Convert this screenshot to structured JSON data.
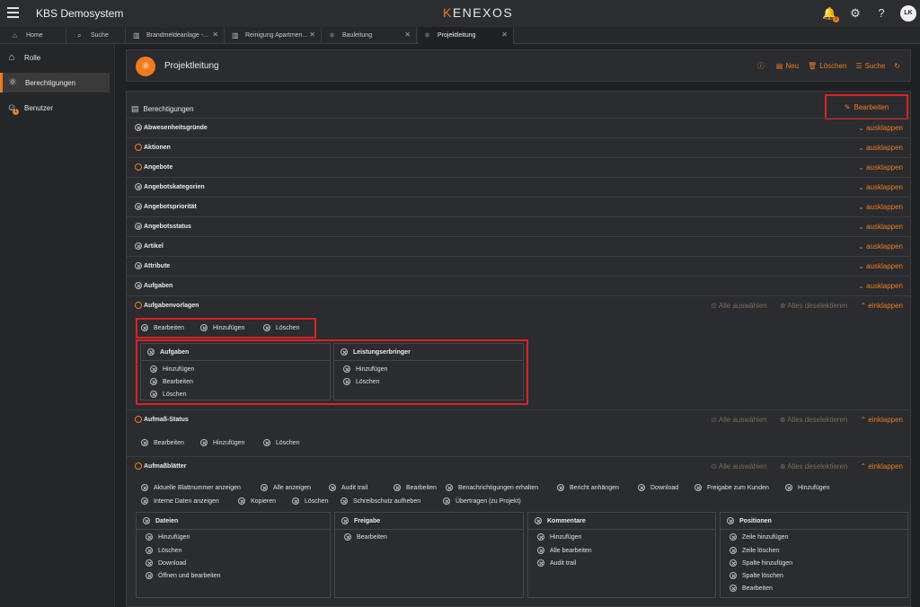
{
  "app": {
    "system_name": "KBS Demosystem",
    "logo_prefix": "K",
    "logo_rest": "ENEXOS",
    "avatar": "LK",
    "notif_badge": "3"
  },
  "tabs": [
    {
      "label": "Home",
      "icon": "home-icon"
    },
    {
      "label": "Suche",
      "icon": "search-icon"
    },
    {
      "label": "Brandmeldeanlage -...",
      "icon": "building-icon"
    },
    {
      "label": "Reinigung Apartmen...",
      "icon": "building-icon"
    },
    {
      "label": "Bauleitung",
      "icon": "atom-icon"
    },
    {
      "label": "Projektleitung",
      "icon": "atom-icon"
    }
  ],
  "sidebar": {
    "items": [
      {
        "label": "Rolle",
        "icon": "home-icon"
      },
      {
        "label": "Berechtigungen",
        "icon": "atom-icon"
      },
      {
        "label": "Benutzer",
        "icon": "user-icon",
        "badge": "1"
      }
    ]
  },
  "header": {
    "title": "Projektleitung",
    "actions": [
      {
        "label": "",
        "icon": "info-icon"
      },
      {
        "label": "Neu",
        "icon": "new-icon"
      },
      {
        "label": "Löschen",
        "icon": "trash-icon"
      },
      {
        "label": "Suche",
        "icon": "list-icon"
      },
      {
        "label": "",
        "icon": "refresh-icon"
      }
    ]
  },
  "card": {
    "title": "Berechtigungen",
    "edit_label": "Bearbeiten",
    "expand_label": "ausklappen",
    "collapse_label": "einklappen",
    "select_all": "Alle auswählen",
    "deselect_all": "Alles deselektieren"
  },
  "rows": [
    {
      "label": "Abwesenheitsgründe",
      "state": "x"
    },
    {
      "label": "Aktionen",
      "state": "ok"
    },
    {
      "label": "Angebote",
      "state": "ok"
    },
    {
      "label": "Angebotskategorien",
      "state": "x"
    },
    {
      "label": "Angebotspriorität",
      "state": "x"
    },
    {
      "label": "Angebotsstatus",
      "state": "x"
    },
    {
      "label": "Artikel",
      "state": "x"
    },
    {
      "label": "Attribute",
      "state": "x"
    },
    {
      "label": "Aufgaben",
      "state": "x"
    },
    {
      "label": "Aufgabenvorlagen",
      "state": "ok"
    },
    {
      "label": "Aufmaß-Status",
      "state": "ok"
    },
    {
      "label": "Aufmaßblätter",
      "state": "ok"
    }
  ],
  "aufgabenvorlagen": {
    "perms": [
      "Bearbeiten",
      "Hinzufügen",
      "Löschen"
    ],
    "subs": [
      {
        "title": "Aufgaben",
        "items": [
          "Hinzufügen",
          "Bearbeiten",
          "Löschen"
        ]
      },
      {
        "title": "Leistungserbringer",
        "items": [
          "Hinzufügen",
          "Löschen"
        ]
      }
    ]
  },
  "aufmass_status": {
    "perms": [
      "Bearbeiten",
      "Hinzufügen",
      "Löschen"
    ]
  },
  "aufmassblaetter": {
    "perms_line1": [
      "Aktuelle Blattnummer anzeigen",
      "Alle anzeigen",
      "Audit trail",
      "Bearbeiten",
      "Benachrichtigungen erhalten",
      "Bericht anhängen",
      "Download",
      "Freigabe zum Kunden",
      "Hinzufügen"
    ],
    "perms_line2": [
      "Interne Daten anzeigen",
      "Kopieren",
      "Löschen",
      "Schreibschutz aufheben",
      "Übertragen (zu Projekt)"
    ],
    "subs": [
      {
        "title": "Dateien",
        "items": [
          "Hinzufügen",
          "Löschen",
          "Download",
          "Öffnen und bearbeiten"
        ]
      },
      {
        "title": "Freigabe",
        "items": [
          "Bearbeiten"
        ]
      },
      {
        "title": "Kommentare",
        "items": [
          "Hinzufügen",
          "Alle bearbeiten",
          "Audit trail"
        ]
      },
      {
        "title": "Positionen",
        "items": [
          "Zeile hinzufügen",
          "Zeile löschen",
          "Spalte hinzufügen",
          "Spalte löschen",
          "Bearbeiten"
        ]
      }
    ]
  }
}
